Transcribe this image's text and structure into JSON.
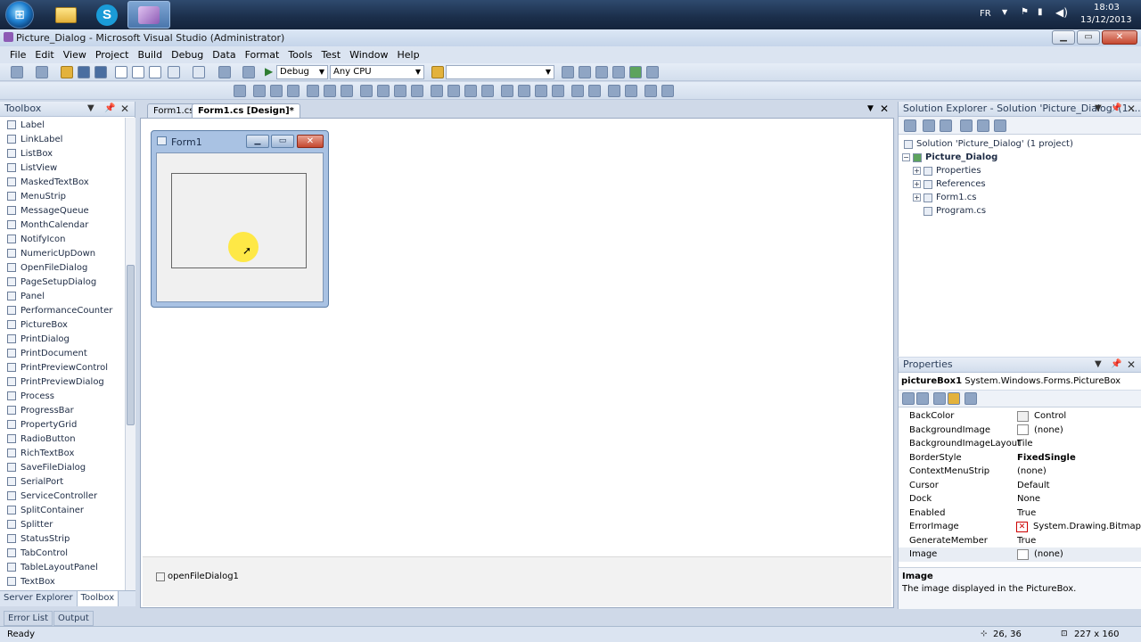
{
  "taskbar": {
    "lang": "FR",
    "time": "18:03",
    "date": "13/12/2013"
  },
  "window": {
    "title": "Picture_Dialog - Microsoft Visual Studio (Administrator)"
  },
  "menu": [
    "File",
    "Edit",
    "View",
    "Project",
    "Build",
    "Debug",
    "Data",
    "Format",
    "Tools",
    "Test",
    "Window",
    "Help"
  ],
  "toolbar": {
    "config": "Debug",
    "platform": "Any CPU"
  },
  "toolbox": {
    "title": "Toolbox",
    "items": [
      "Label",
      "LinkLabel",
      "ListBox",
      "ListView",
      "MaskedTextBox",
      "MenuStrip",
      "MessageQueue",
      "MonthCalendar",
      "NotifyIcon",
      "NumericUpDown",
      "OpenFileDialog",
      "PageSetupDialog",
      "Panel",
      "PerformanceCounter",
      "PictureBox",
      "PrintDialog",
      "PrintDocument",
      "PrintPreviewControl",
      "PrintPreviewDialog",
      "Process",
      "ProgressBar",
      "PropertyGrid",
      "RadioButton",
      "RichTextBox",
      "SaveFileDialog",
      "SerialPort",
      "ServiceController",
      "SplitContainer",
      "Splitter",
      "StatusStrip",
      "TabControl",
      "TableLayoutPanel",
      "TextBox"
    ],
    "tabs": [
      "Server Explorer",
      "Toolbox"
    ]
  },
  "document": {
    "tabs": [
      "Form1.cs",
      "Form1.cs [Design]*"
    ],
    "form_title": "Form1",
    "tray_component": "openFileDialog1"
  },
  "solution": {
    "title": "Solution Explorer - Solution 'Picture_Dialog' (1 ...",
    "root": "Solution 'Picture_Dialog' (1 project)",
    "project": "Picture_Dialog",
    "nodes": [
      "Properties",
      "References",
      "Form1.cs",
      "Program.cs"
    ]
  },
  "properties": {
    "title": "Properties",
    "object_name": "pictureBox1",
    "object_type": "System.Windows.Forms.PictureBox",
    "rows": [
      {
        "name": "BackColor",
        "value": "Control"
      },
      {
        "name": "BackgroundImage",
        "value": "(none)"
      },
      {
        "name": "BackgroundImageLayout",
        "value": "Tile"
      },
      {
        "name": "BorderStyle",
        "value": "FixedSingle"
      },
      {
        "name": "ContextMenuStrip",
        "value": "(none)"
      },
      {
        "name": "Cursor",
        "value": "Default"
      },
      {
        "name": "Dock",
        "value": "None"
      },
      {
        "name": "Enabled",
        "value": "True"
      },
      {
        "name": "ErrorImage",
        "value": "System.Drawing.Bitmap"
      },
      {
        "name": "GenerateMember",
        "value": "True"
      },
      {
        "name": "Image",
        "value": "(none)"
      }
    ],
    "desc_title": "Image",
    "desc_text": "The image displayed in the PictureBox."
  },
  "bottom_tabs": [
    "Error List",
    "Output"
  ],
  "status": {
    "text": "Ready",
    "position": "26, 36",
    "size": "227 x 160"
  }
}
